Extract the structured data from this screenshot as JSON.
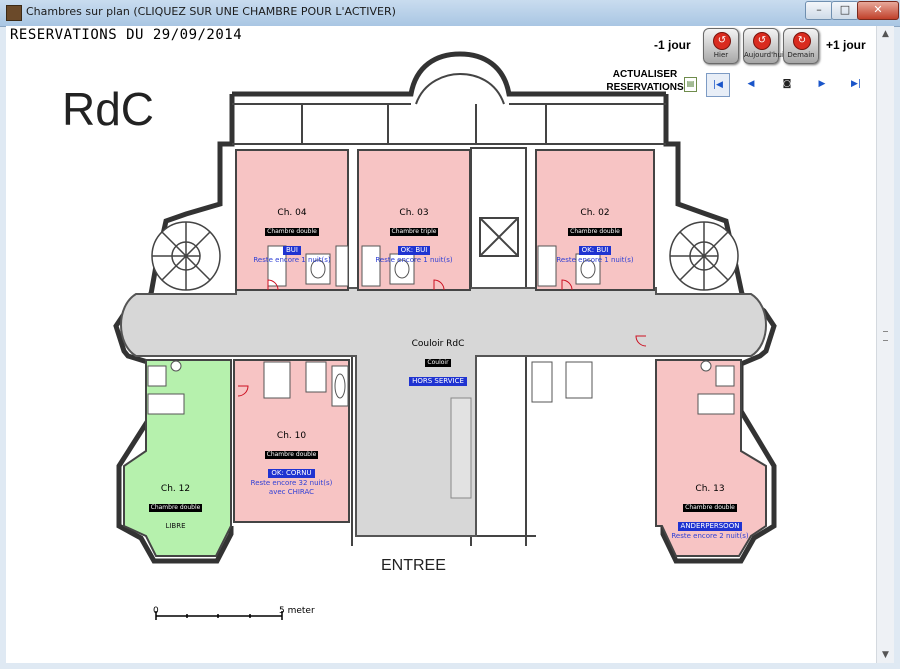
{
  "window": {
    "title": "Chambres sur plan (CLIQUEZ SUR UNE CHAMBRE POUR L'ACTIVER)",
    "min": "–",
    "max": "□",
    "close": "✕"
  },
  "header": {
    "reservations_title": "RESERVATIONS DU 29/09/2014",
    "level": "RdC"
  },
  "nav": {
    "minus_label": "-1 jour",
    "plus_label": "+1 jour",
    "hier": "Hier",
    "today": "Aujourd'hui",
    "demain": "Demain",
    "refresh_label_1": "ACTUALISER",
    "refresh_label_2": "RESERVATIONS",
    "first_icon": "first-record-icon",
    "prev_icon": "previous-record-icon",
    "find_icon": "find-icon",
    "next_icon": "next-record-icon",
    "last_icon": "last-record-icon"
  },
  "colors": {
    "occupied": "#f7c4c4",
    "free": "#b6f1ad",
    "corridor": "#d7d7d7",
    "status_bg": "#1f33d1"
  },
  "rooms": {
    "ch04": {
      "name": "Ch. 04",
      "type": "Chambre double",
      "status": "BUI",
      "note": "Reste encore 1 nuit(s)"
    },
    "ch03": {
      "name": "Ch. 03",
      "type": "Chambre triple",
      "status": "OK: BUI",
      "note": "Reste encore 1 nuit(s)"
    },
    "ch02": {
      "name": "Ch. 02",
      "type": "Chambre double",
      "status": "OK: BUI",
      "note": "Reste encore 1 nuit(s)"
    },
    "ch10": {
      "name": "Ch. 10",
      "type": "Chambre double",
      "status": "OK: CORNU",
      "note": "Reste encore 32 nuit(s)",
      "note2": "avec CHIRAC"
    },
    "ch12": {
      "name": "Ch. 12",
      "type": "Chambre double",
      "status": "LIBRE"
    },
    "ch13": {
      "name": "Ch. 13",
      "type": "Chambre double",
      "status": "ANDERPERSOON",
      "note": "Reste encore 2 nuit(s)"
    },
    "couloir": {
      "name": "Couloir RdC",
      "type": "Couloir",
      "status": "HORS SERVICE"
    }
  },
  "plan": {
    "entrance": "ENTREE",
    "scale_start": "0",
    "scale_end": "5 meter"
  }
}
